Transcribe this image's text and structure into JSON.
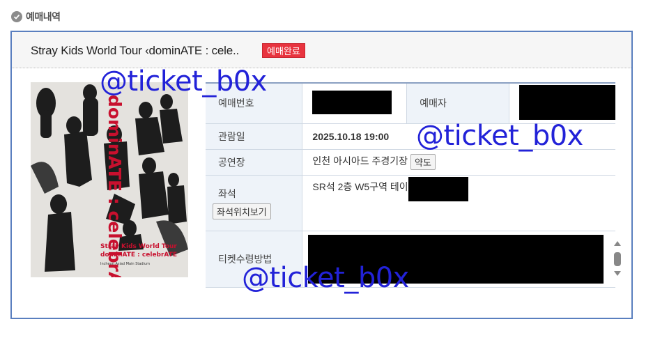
{
  "section": {
    "title": "예매내역",
    "icon": "check-icon"
  },
  "booking": {
    "show_title": "Stray Kids World Tour ‹dominATE : cele..",
    "status": "예매완료",
    "poster": {
      "vertical_text": "dominATE : celebrATE",
      "line1": "Stray Kids World Tour",
      "line2": "dominATE : celebrATE",
      "venue": "Incheon Asiad Main Stadium"
    },
    "rows": {
      "booking_no_label": "예매번호",
      "booker_label": "예매자",
      "date_label": "관람일",
      "date_value": "2025.10.18 19:00",
      "venue_label": "공연장",
      "venue_value": "인천 아시아드 주경기장",
      "map_button": "약도",
      "seat_label": "좌석",
      "seat_button": "좌석위치보기",
      "seat_value": "SR석 2층 W5구역 테이",
      "pickup_label": "티켓수령방법"
    }
  },
  "watermark": "@ticket_b0x",
  "colors": {
    "accent": "#5a7fbf",
    "badge": "#e8343f",
    "watermark": "#2222d8"
  }
}
